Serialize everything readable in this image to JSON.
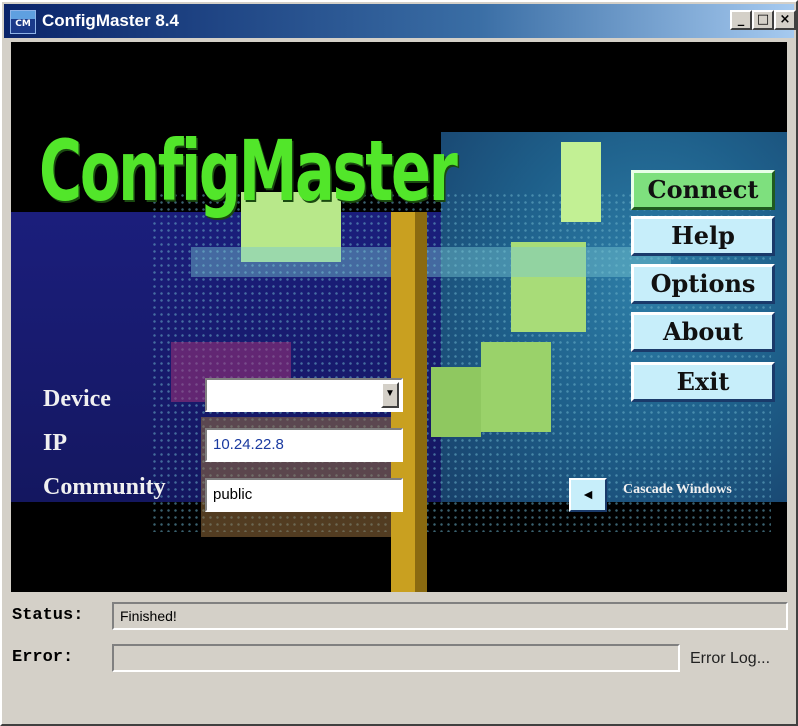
{
  "window": {
    "title": "ConfigMaster 8.4",
    "icon_label": "CM"
  },
  "titlebar_buttons": {
    "minimize": "_",
    "maximize": "□",
    "close": "×"
  },
  "logo": "ConfigMaster",
  "side_buttons": {
    "connect": "Connect",
    "help": "Help",
    "options": "Options",
    "about": "About",
    "exit": "Exit"
  },
  "form": {
    "device_label": "Device",
    "device_value": "",
    "ip_label": "IP",
    "ip_value": "10.24.22.8",
    "community_label": "Community",
    "community_value": "public"
  },
  "cascade": {
    "arrow": "◄",
    "label": "Cascade Windows"
  },
  "status": {
    "label": "Status:",
    "value": "Finished!"
  },
  "error": {
    "label": "Error:",
    "value": "",
    "log_link": "Error Log..."
  },
  "colors": {
    "logo_green": "#52e62a",
    "button_face": "#c7eefa",
    "connect_green": "#7ee07e",
    "titlebar_blue": "#0a246a",
    "canvas_blue": "#1b1e7c"
  },
  "icons": {
    "app": "cm-app-icon",
    "combo": "dropdown-arrow-icon",
    "cascade": "left-arrow-icon"
  }
}
